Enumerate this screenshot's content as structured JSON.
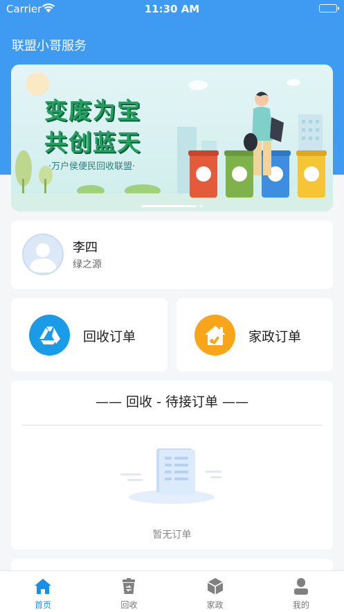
{
  "status_bar": {
    "carrier": "Carrier",
    "time": "11:30 AM"
  },
  "header": {
    "title": "联盟小哥服务"
  },
  "banner": {
    "headline_1": "变废为宝",
    "headline_2": "共创蓝天",
    "subline": "·万户侯便民回收联盟·",
    "slide_index": 1,
    "slide_count": 2
  },
  "profile": {
    "name": "李四",
    "subtitle": "绿之源",
    "avatar_icon": "user-avatar-placeholder-icon"
  },
  "orders": [
    {
      "label": "回收订单",
      "icon": "recycle-triangle-icon",
      "color": "#1a9be8"
    },
    {
      "label": "家政订单",
      "icon": "house-broom-icon",
      "color": "#f8a51a"
    }
  ],
  "pending": {
    "title": "—— 回收 - 待接订单 ——",
    "empty_text": "暂无订单",
    "empty_icon": "empty-document-icon"
  },
  "tabs": [
    {
      "label": "首页",
      "icon": "home-icon",
      "active": true
    },
    {
      "label": "回收",
      "icon": "recycle-bin-icon",
      "active": false
    },
    {
      "label": "家政",
      "icon": "cube-icon",
      "active": false
    },
    {
      "label": "我的",
      "icon": "person-icon",
      "active": false
    }
  ],
  "colors": {
    "primary": "#3f9bf2",
    "tab_active": "#1a8fe6",
    "banner_green": "#23a060"
  }
}
